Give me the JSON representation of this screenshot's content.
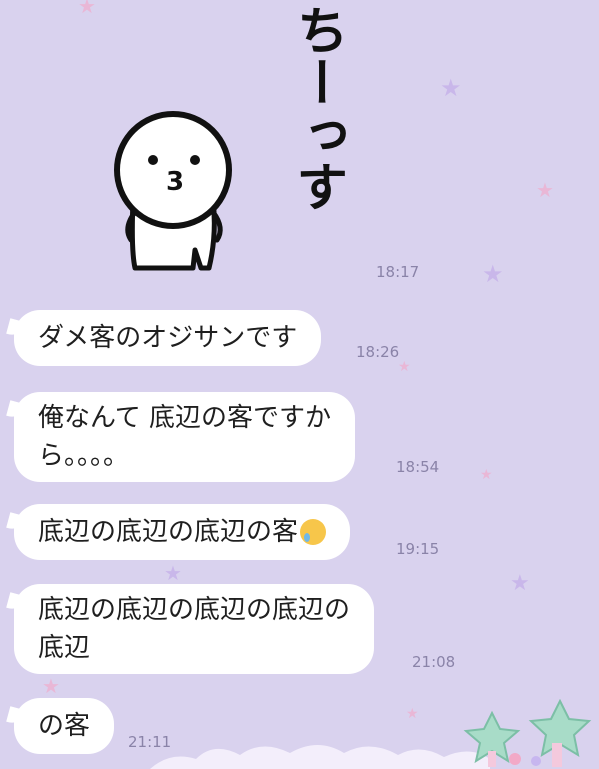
{
  "chat": {
    "sticker": {
      "text": "ちーっす",
      "time": "18:17"
    },
    "messages": [
      {
        "text": "ダメ客のオジサンです",
        "time": "18:26"
      },
      {
        "text": "俺なんて 底辺の客ですか\nら。。。。",
        "time": "18:54"
      },
      {
        "text": "底辺の底辺の底辺の客",
        "emoji": "crying-face-icon",
        "time": "19:15"
      },
      {
        "text": "底辺の底辺の底辺の底辺の\n底辺",
        "time": "21:08"
      },
      {
        "text": "の客",
        "time": "21:11"
      }
    ]
  },
  "colors": {
    "background": "#d9d2ee",
    "bubble": "#ffffff",
    "timestamp": "#8a83a8",
    "star": "#e9b7d6"
  }
}
